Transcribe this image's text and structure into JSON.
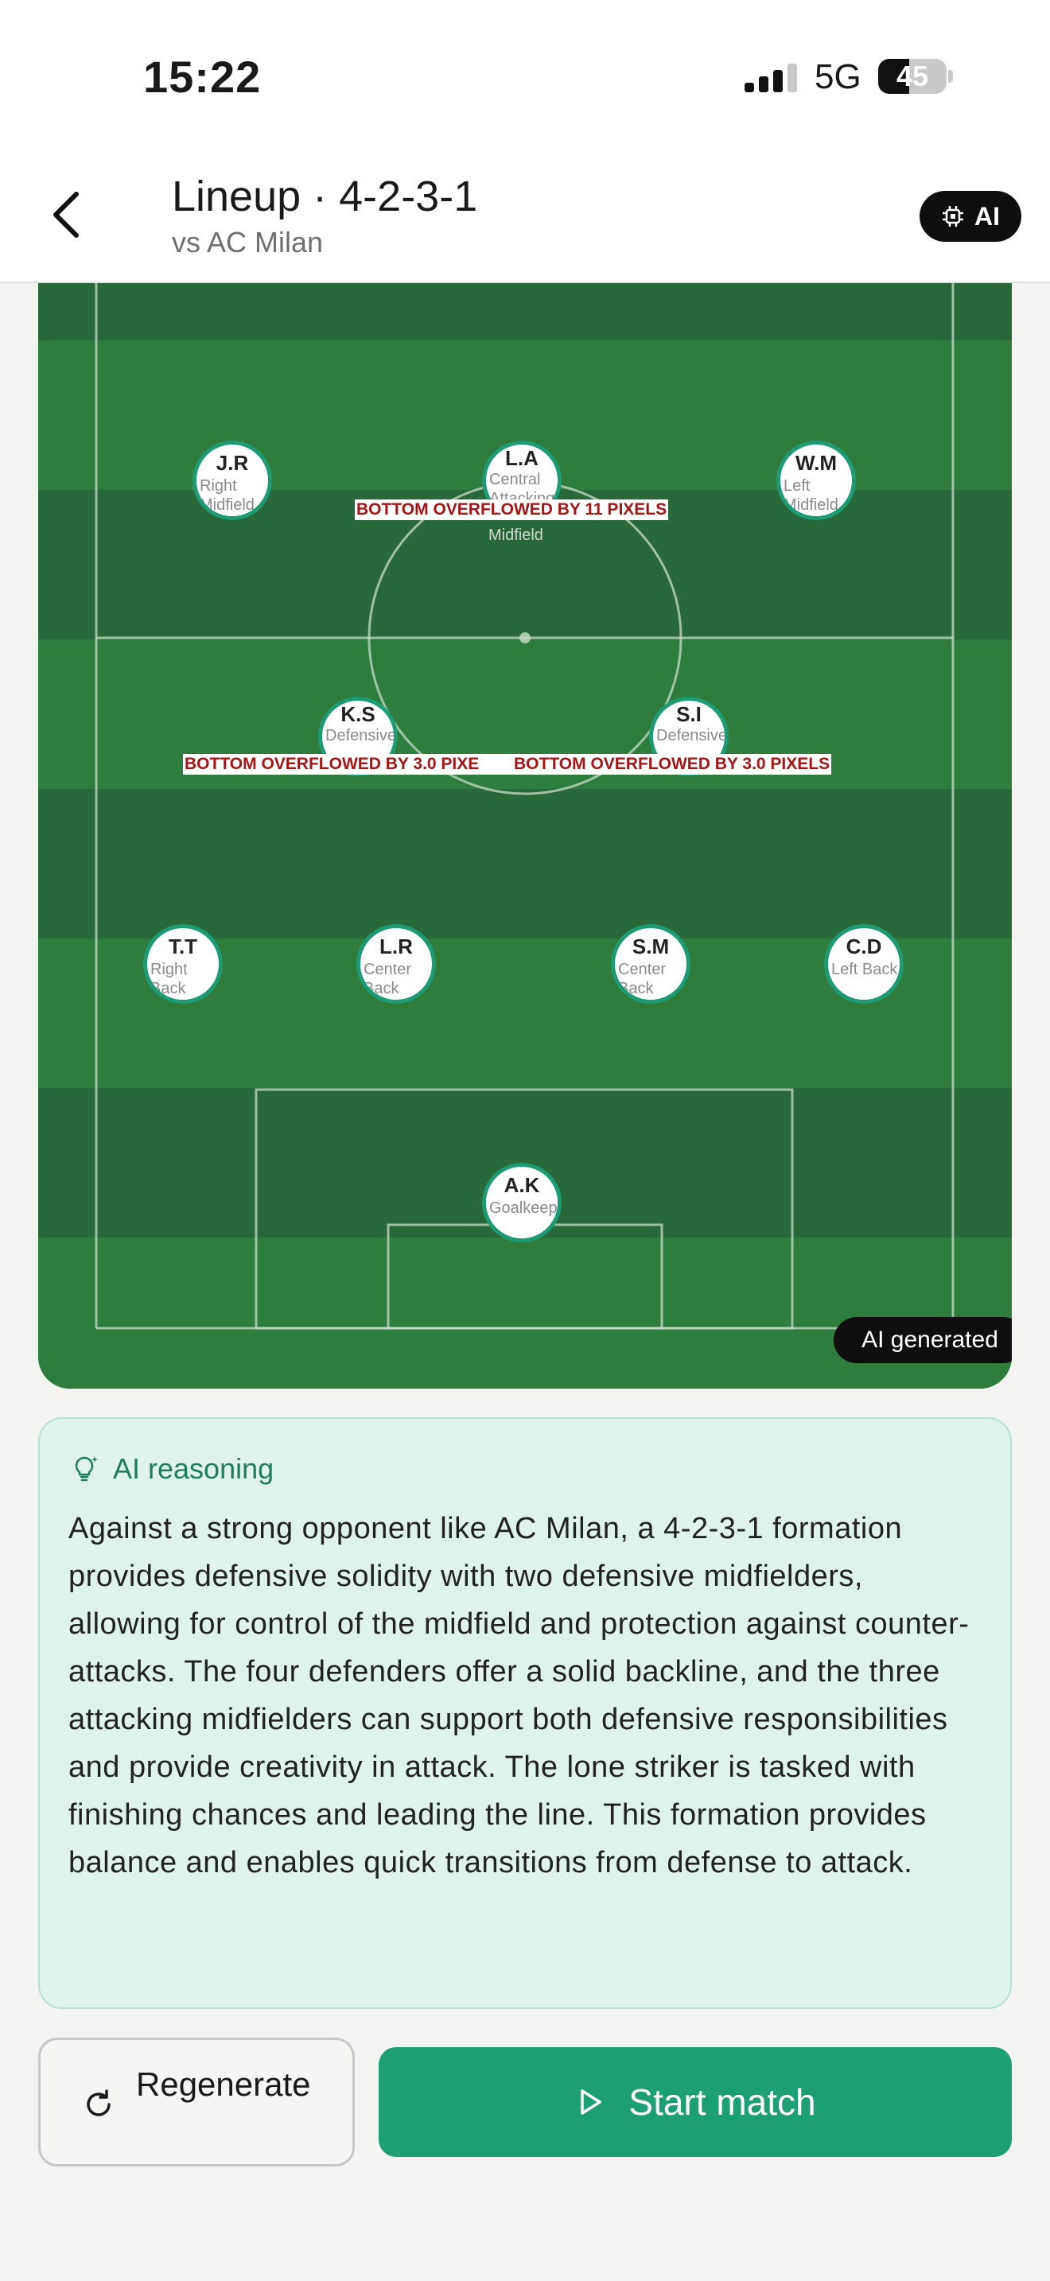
{
  "status_bar": {
    "time": "15:22",
    "network": "5G",
    "battery": "45",
    "battery_level": 0.45
  },
  "header": {
    "title": "Lineup · 4-2-3-1",
    "subtitle": "vs AC Milan",
    "ai_chip_label": "AI"
  },
  "players": [
    {
      "initials": "J.R",
      "role": "Right Midfield"
    },
    {
      "initials": "L.A",
      "role": "Central Attacking",
      "role_overflow": "Midfield"
    },
    {
      "initials": "W.M",
      "role": "Left Midfield"
    },
    {
      "initials": "K.S",
      "role": "Defensive"
    },
    {
      "initials": "S.I",
      "role": "Defensive"
    },
    {
      "initials": "T.T",
      "role": "Right Back"
    },
    {
      "initials": "L.R",
      "role": "Center Back"
    },
    {
      "initials": "S.M",
      "role": "Center Back"
    },
    {
      "initials": "C.D",
      "role": "Left Back"
    },
    {
      "initials": "A.K",
      "role": "Goalkeeper"
    }
  ],
  "overflow_warnings": [
    "BOTTOM OVERFLOWED BY 11 PIXELS",
    "BOTTOM OVERFLOWED BY 3.0 PIXE",
    "BOTTOM OVERFLOWED BY 3.0 PIXELS"
  ],
  "pitch": {
    "ai_generated_label": "AI generated",
    "dark_stripe": "#28683a",
    "light_stripe": "#2f7d3d"
  },
  "reasoning": {
    "title": "AI reasoning",
    "text": "Against a strong opponent like AC Milan, a 4-2-3-1 formation provides defensive solidity with two defensive midfielders, allowing for control of the midfield and protection against counter-attacks. The four defenders offer a solid backline, and the three attacking midfielders can support both defensive responsibilities and provide creativity in attack. The lone striker is tasked with finishing chances and leading the line. This formation provides balance and enables quick transitions from defense to attack."
  },
  "actions": {
    "regenerate_label": "Regenerate",
    "start_label": "Start match"
  },
  "colors": {
    "accent": "#1d9f74",
    "card_bg": "#e0f2ec",
    "card_text": "#1e7d5e"
  }
}
